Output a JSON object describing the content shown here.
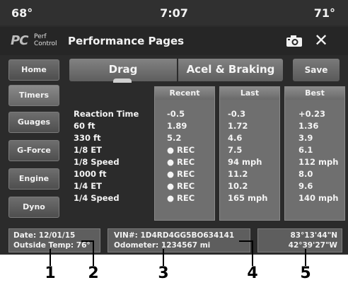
{
  "status": {
    "left_temp": "68°",
    "time": "7:07",
    "right_temp": "71°"
  },
  "titlebar": {
    "logo_text": "PC",
    "logo_sub_1": "Perf",
    "logo_sub_2": "Control",
    "title": "Performance Pages",
    "camera_icon": "camera-icon",
    "close_glyph": "✕"
  },
  "nav": [
    {
      "label": "Home",
      "active": false
    },
    {
      "label": "Timers",
      "active": true
    },
    {
      "label": "Guages",
      "active": false
    },
    {
      "label": "G-Force",
      "active": false
    },
    {
      "label": "Engine",
      "active": false
    },
    {
      "label": "Dyno",
      "active": false
    }
  ],
  "tabs": {
    "drag": "Drag",
    "accel": "Acel & Braking",
    "active": "Drag"
  },
  "save_label": "Save",
  "table": {
    "headers": {
      "recent": "Recent",
      "last": "Last",
      "best": "Best"
    },
    "rows": [
      {
        "label": "Reaction Time",
        "recent": "-0.5",
        "last": "-0.3",
        "best": "+0.23"
      },
      {
        "label": "60 ft",
        "recent": "1.89",
        "last": "1.72",
        "best": "1.36"
      },
      {
        "label": "330 ft",
        "recent": "5.2",
        "last": "4.6",
        "best": "3.9"
      },
      {
        "label": "1/8 ET",
        "recent": "● REC",
        "last": "7.5",
        "best": "6.1"
      },
      {
        "label": "1/8 Speed",
        "recent": "● REC",
        "last": "94 mph",
        "best": "112 mph"
      },
      {
        "label": "1000 ft",
        "recent": "● REC",
        "last": "11.2",
        "best": "8.0"
      },
      {
        "label": "1/4 ET",
        "recent": "● REC",
        "last": "10.2",
        "best": "9.6"
      },
      {
        "label": "1/4 Speed",
        "recent": "● REC",
        "last": "165 mph",
        "best": "140 mph"
      }
    ]
  },
  "footer": {
    "date": "Date: 12/01/15",
    "outside_temp": "Outside Temp: 76°",
    "vin": "VIN#: 1D4RD4GG5BO634141",
    "odometer": "Odometer: 1234567 mi",
    "lat": "83°13'44\"N",
    "lon": "42°39'27\"W"
  },
  "callouts": [
    "1",
    "2",
    "3",
    "4",
    "5"
  ],
  "colors": {
    "screen_bg": "#2b2b2b",
    "panel": "#6f6f6f",
    "text": "#f2f2f2"
  }
}
